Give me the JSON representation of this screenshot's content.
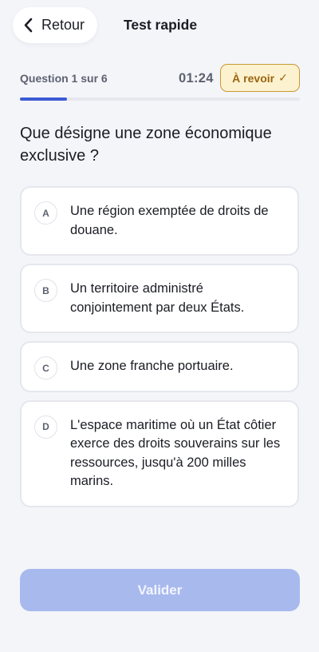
{
  "header": {
    "back_label": "Retour",
    "title": "Test rapide"
  },
  "status": {
    "question_counter": "Question 1 sur 6",
    "timer": "01:24",
    "review_label": "À revoir",
    "review_check": "✓"
  },
  "progress": {
    "current": 1,
    "total": 6
  },
  "question": {
    "text": "Que désigne une zone économique exclusive ?"
  },
  "answers": [
    {
      "letter": "A",
      "text": "Une région exemptée de droits de douane."
    },
    {
      "letter": "B",
      "text": "Un territoire administré conjointement par deux États."
    },
    {
      "letter": "C",
      "text": "Une zone franche portuaire."
    },
    {
      "letter": "D",
      "text": "L'espace maritime où un État côtier exerce des droits souverains sur les ressources, jusqu'à 200 milles marins."
    }
  ],
  "footer": {
    "validate_label": "Valider",
    "validate_enabled": false
  },
  "colors": {
    "accent": "#3b5bd3",
    "validate_disabled": "#a8b9ee",
    "review_bg": "#fdf2cf",
    "review_border": "#c79a34",
    "background": "#f4f5f9"
  },
  "icons": {
    "back": "chevron-left-icon"
  }
}
